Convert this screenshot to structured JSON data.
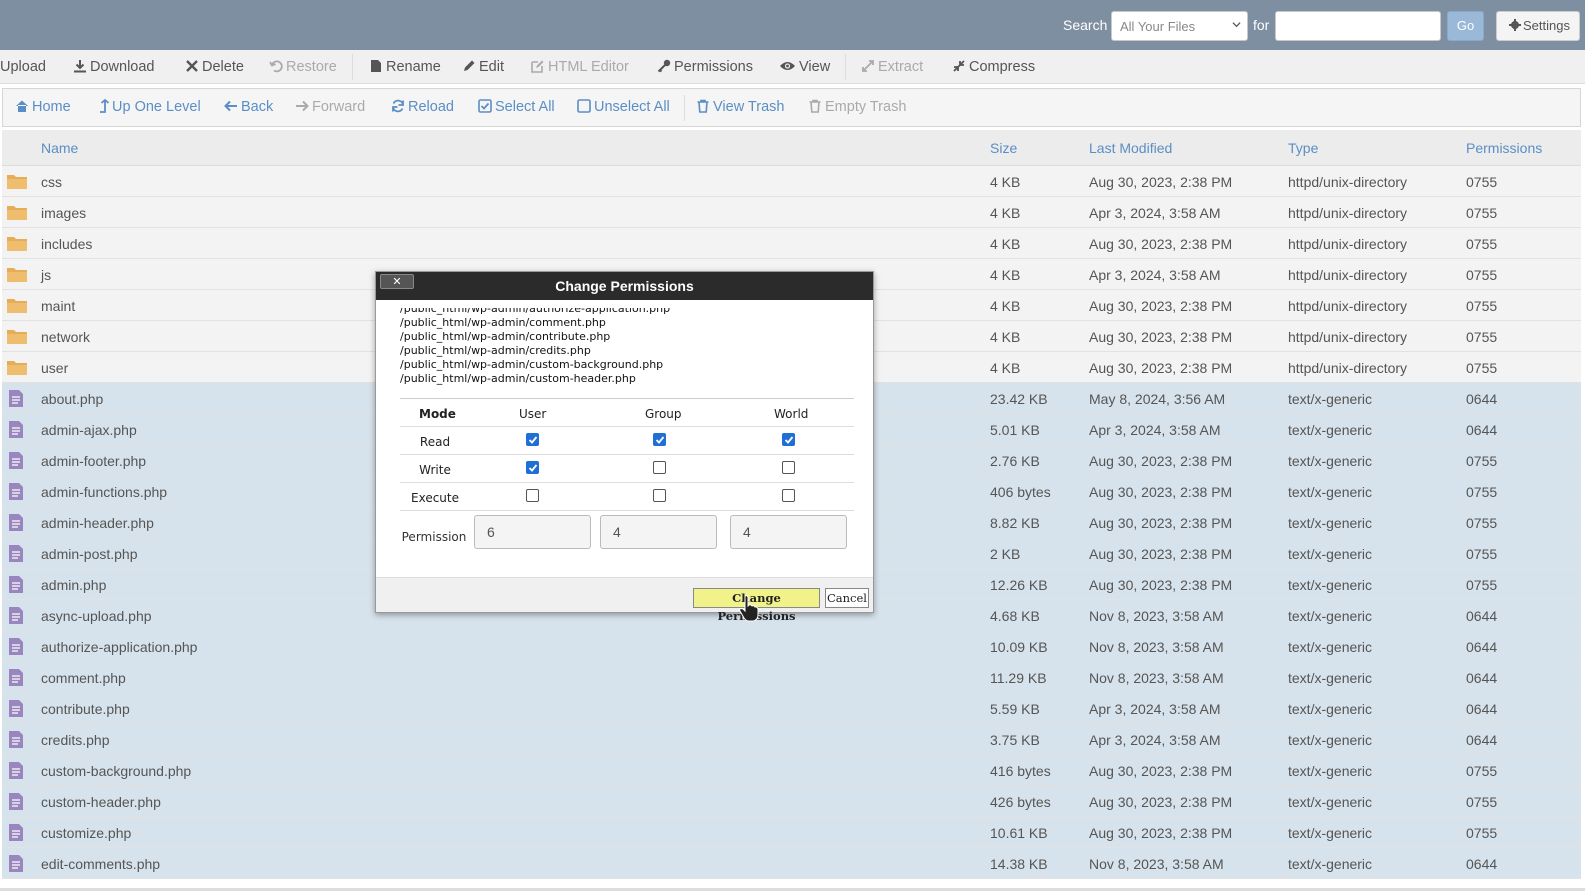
{
  "topbar": {
    "search_label": "Search",
    "search_scope": "All Your Files",
    "for_label": "for",
    "search_value": "",
    "go_label": "Go",
    "settings_label": "Settings"
  },
  "toolbar1": {
    "upload": "Upload",
    "download": "Download",
    "delete": "Delete",
    "restore": "Restore",
    "rename": "Rename",
    "edit": "Edit",
    "html_editor": "HTML Editor",
    "permissions": "Permissions",
    "view": "View",
    "extract": "Extract",
    "compress": "Compress"
  },
  "toolbar2": {
    "home": "Home",
    "up_one_level": "Up One Level",
    "back": "Back",
    "forward": "Forward",
    "reload": "Reload",
    "select_all": "Select All",
    "unselect_all": "Unselect All",
    "view_trash": "View Trash",
    "empty_trash": "Empty Trash"
  },
  "table": {
    "headers": {
      "name": "Name",
      "size": "Size",
      "last_modified": "Last Modified",
      "type": "Type",
      "permissions": "Permissions"
    },
    "rows": [
      {
        "name": "css",
        "size": "4 KB",
        "date": "Aug 30, 2023, 2:38 PM",
        "type": "httpd/unix-directory",
        "perm": "0755",
        "kind": "dir"
      },
      {
        "name": "images",
        "size": "4 KB",
        "date": "Apr 3, 2024, 3:58 AM",
        "type": "httpd/unix-directory",
        "perm": "0755",
        "kind": "dir"
      },
      {
        "name": "includes",
        "size": "4 KB",
        "date": "Aug 30, 2023, 2:38 PM",
        "type": "httpd/unix-directory",
        "perm": "0755",
        "kind": "dir"
      },
      {
        "name": "js",
        "size": "4 KB",
        "date": "Apr 3, 2024, 3:58 AM",
        "type": "httpd/unix-directory",
        "perm": "0755",
        "kind": "dir"
      },
      {
        "name": "maint",
        "size": "4 KB",
        "date": "Aug 30, 2023, 2:38 PM",
        "type": "httpd/unix-directory",
        "perm": "0755",
        "kind": "dir"
      },
      {
        "name": "network",
        "size": "4 KB",
        "date": "Aug 30, 2023, 2:38 PM",
        "type": "httpd/unix-directory",
        "perm": "0755",
        "kind": "dir"
      },
      {
        "name": "user",
        "size": "4 KB",
        "date": "Aug 30, 2023, 2:38 PM",
        "type": "httpd/unix-directory",
        "perm": "0755",
        "kind": "dir"
      },
      {
        "name": "about.php",
        "size": "23.42 KB",
        "date": "May 8, 2024, 3:56 AM",
        "type": "text/x-generic",
        "perm": "0644",
        "kind": "file"
      },
      {
        "name": "admin-ajax.php",
        "size": "5.01 KB",
        "date": "Apr 3, 2024, 3:58 AM",
        "type": "text/x-generic",
        "perm": "0644",
        "kind": "file"
      },
      {
        "name": "admin-footer.php",
        "size": "2.76 KB",
        "date": "Aug 30, 2023, 2:38 PM",
        "type": "text/x-generic",
        "perm": "0755",
        "kind": "file"
      },
      {
        "name": "admin-functions.php",
        "size": "406 bytes",
        "date": "Aug 30, 2023, 2:38 PM",
        "type": "text/x-generic",
        "perm": "0755",
        "kind": "file"
      },
      {
        "name": "admin-header.php",
        "size": "8.82 KB",
        "date": "Aug 30, 2023, 2:38 PM",
        "type": "text/x-generic",
        "perm": "0755",
        "kind": "file"
      },
      {
        "name": "admin-post.php",
        "size": "2 KB",
        "date": "Aug 30, 2023, 2:38 PM",
        "type": "text/x-generic",
        "perm": "0755",
        "kind": "file"
      },
      {
        "name": "admin.php",
        "size": "12.26 KB",
        "date": "Aug 30, 2023, 2:38 PM",
        "type": "text/x-generic",
        "perm": "0755",
        "kind": "file"
      },
      {
        "name": "async-upload.php",
        "size": "4.68 KB",
        "date": "Nov 8, 2023, 3:58 AM",
        "type": "text/x-generic",
        "perm": "0644",
        "kind": "file"
      },
      {
        "name": "authorize-application.php",
        "size": "10.09 KB",
        "date": "Nov 8, 2023, 3:58 AM",
        "type": "text/x-generic",
        "perm": "0644",
        "kind": "file"
      },
      {
        "name": "comment.php",
        "size": "11.29 KB",
        "date": "Nov 8, 2023, 3:58 AM",
        "type": "text/x-generic",
        "perm": "0644",
        "kind": "file"
      },
      {
        "name": "contribute.php",
        "size": "5.59 KB",
        "date": "Apr 3, 2024, 3:58 AM",
        "type": "text/x-generic",
        "perm": "0644",
        "kind": "file"
      },
      {
        "name": "credits.php",
        "size": "3.75 KB",
        "date": "Apr 3, 2024, 3:58 AM",
        "type": "text/x-generic",
        "perm": "0644",
        "kind": "file"
      },
      {
        "name": "custom-background.php",
        "size": "416 bytes",
        "date": "Aug 30, 2023, 2:38 PM",
        "type": "text/x-generic",
        "perm": "0755",
        "kind": "file"
      },
      {
        "name": "custom-header.php",
        "size": "426 bytes",
        "date": "Aug 30, 2023, 2:38 PM",
        "type": "text/x-generic",
        "perm": "0755",
        "kind": "file"
      },
      {
        "name": "customize.php",
        "size": "10.61 KB",
        "date": "Aug 30, 2023, 2:38 PM",
        "type": "text/x-generic",
        "perm": "0755",
        "kind": "file"
      },
      {
        "name": "edit-comments.php",
        "size": "14.38 KB",
        "date": "Nov 8, 2023, 3:58 AM",
        "type": "text/x-generic",
        "perm": "0644",
        "kind": "file"
      }
    ]
  },
  "dialog": {
    "title": "Change Permissions",
    "close_label": "✕",
    "files": [
      "/public_html/wp-admin/authorize-application.php",
      "/public_html/wp-admin/comment.php",
      "/public_html/wp-admin/contribute.php",
      "/public_html/wp-admin/credits.php",
      "/public_html/wp-admin/custom-background.php",
      "/public_html/wp-admin/custom-header.php"
    ],
    "mode_label": "Mode",
    "user_label": "User",
    "group_label": "Group",
    "world_label": "World",
    "read_label": "Read",
    "write_label": "Write",
    "execute_label": "Execute",
    "permission_label": "Permission",
    "checks": {
      "read": [
        true,
        true,
        true
      ],
      "write": [
        true,
        false,
        false
      ],
      "execute": [
        false,
        false,
        false
      ]
    },
    "user_value": "6",
    "group_value": "4",
    "world_value": "4",
    "change_label": "Change Permissions",
    "cancel_label": "Cancel"
  },
  "colors": {
    "topbar": "#7e8fa1",
    "link": "#5b8ec4",
    "file_row": "#d7e3ec",
    "folder": "#e5ad58",
    "file_icon": "#9a86bf",
    "checkbox_on": "#1f6fd6",
    "change_button": "#f2f28a"
  }
}
